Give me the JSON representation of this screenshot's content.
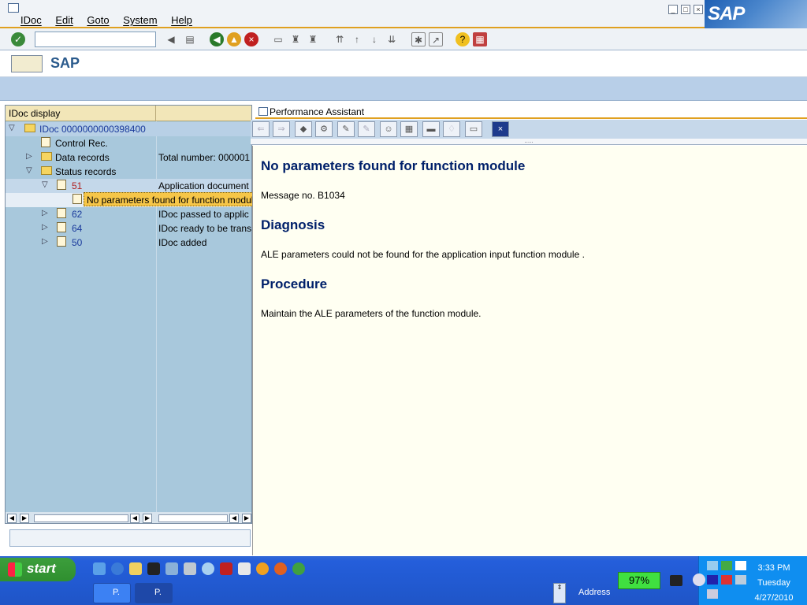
{
  "menu": {
    "items": [
      "IDoc",
      "Edit",
      "Goto",
      "System",
      "Help"
    ]
  },
  "brand": "SAP",
  "title": "SAP",
  "tree": {
    "header": "IDoc display",
    "rows": [
      {
        "label": "IDoc 0000000000398400",
        "col2": ""
      },
      {
        "label": "Control Rec.",
        "col2": ""
      },
      {
        "label": "Data records",
        "col2": "Total number: 000001"
      },
      {
        "label": "Status records",
        "col2": ""
      },
      {
        "label": "51",
        "col2": "Application document"
      },
      {
        "label": "62",
        "col2": "IDoc passed to applic"
      },
      {
        "label": "64",
        "col2": "IDoc ready to be trans"
      },
      {
        "label": "50",
        "col2": "IDoc added"
      }
    ],
    "tooltip": "No parameters found for function module"
  },
  "perf": {
    "title": "Performance Assistant",
    "heading": "No parameters found for function module",
    "message_no": "Message no. B1034",
    "diagnosis_heading": "Diagnosis",
    "diagnosis_text": "ALE parameters could not be found for the application input function module .",
    "procedure_heading": "Procedure",
    "procedure_text": "Maintain the ALE parameters of the function module."
  },
  "taskbar": {
    "start": "start",
    "items": [
      "P.",
      "P."
    ],
    "battery": "97%",
    "address_label": "Address",
    "time": "3:33 PM",
    "day": "Tuesday",
    "date": "4/27/2010"
  }
}
